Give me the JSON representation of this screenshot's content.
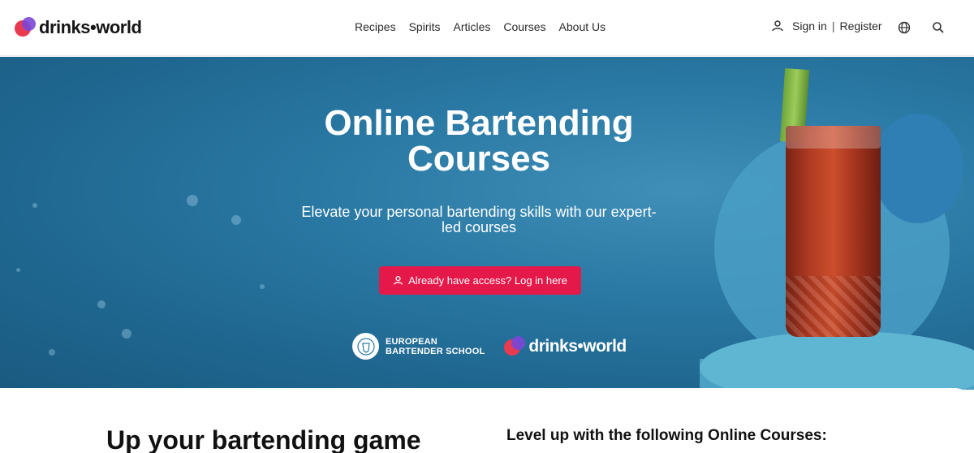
{
  "brand": {
    "name": "drinks•world"
  },
  "nav": {
    "items": [
      "Recipes",
      "Spirits",
      "Articles",
      "Courses",
      "About Us"
    ]
  },
  "account": {
    "sign_in": "Sign in",
    "separator": "|",
    "register": "Register"
  },
  "icons": {
    "user": "user-icon",
    "globe": "globe-icon",
    "search": "search-icon"
  },
  "hero": {
    "title": "Online Bartending Courses",
    "subtitle": "Elevate your personal bartending skills with our expert-led courses",
    "cta": "Already have access? Log in here",
    "partners": {
      "ebs_line1": "EUROPEAN",
      "ebs_line2": "BARTENDER SCHOOL",
      "dw_name": "drinks•world"
    }
  },
  "section": {
    "left_heading": "Up your bartending game",
    "right_heading": "Level up with the following Online Courses:"
  },
  "colors": {
    "accent": "#e5184a",
    "brand_red": "#ea3a4f",
    "brand_purple": "#7a47d8",
    "hero_blue": "#2a7aa5"
  }
}
